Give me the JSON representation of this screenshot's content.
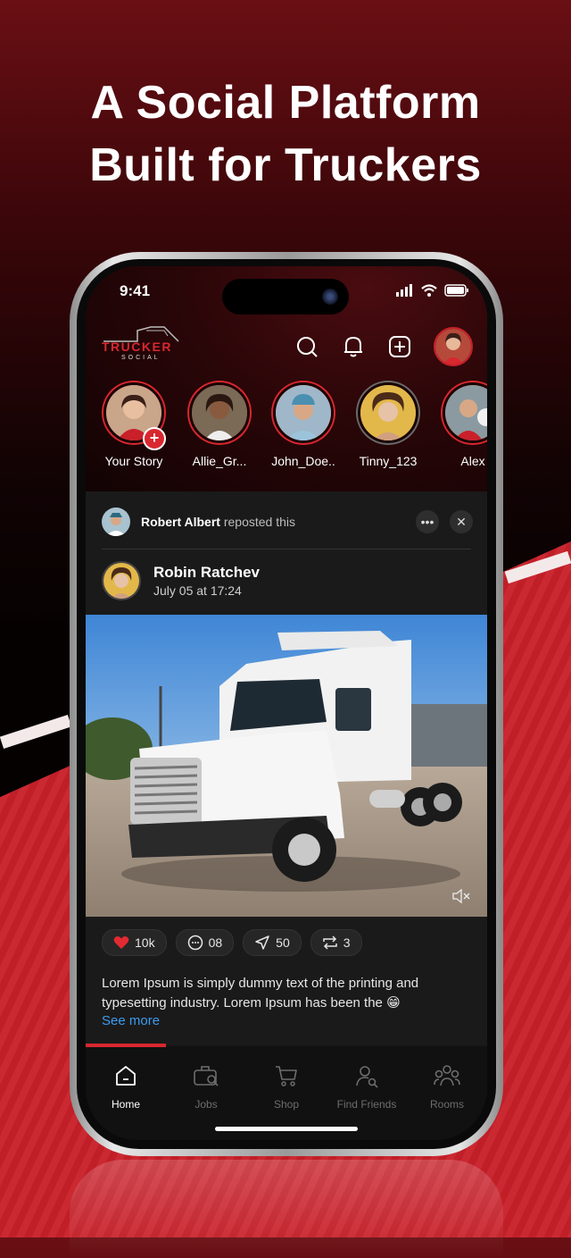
{
  "headline": {
    "line1": "A Social Platform",
    "line2": "Built for Truckers"
  },
  "status_bar": {
    "time": "9:41"
  },
  "app": {
    "logo_text": "TRUCKER",
    "logo_sub": "SOCIAL"
  },
  "header_icons": [
    "search-icon",
    "bell-icon",
    "add-post-icon",
    "profile-avatar"
  ],
  "stories": [
    {
      "label": "Your Story",
      "ring": "#d9272f"
    },
    {
      "label": "Allie_Gr...",
      "ring": "#d9272f"
    },
    {
      "label": "John_Doe..",
      "ring": "#d9272f"
    },
    {
      "label": "Tinny_123",
      "ring": "#6a6a6a"
    },
    {
      "label": "Alex",
      "ring": "#d9272f"
    }
  ],
  "repost": {
    "user": "Robert Albert",
    "action": "reposted this"
  },
  "post": {
    "author": "Robin Ratchev",
    "date": "July 05 at 17:24",
    "likes": "10k",
    "comments": "08",
    "shares": "50",
    "reposts": "3",
    "caption": "Lorem Ipsum is simply dummy text of the printing and typesetting industry. Lorem Ipsum has been the 😁",
    "see_more": "See more"
  },
  "tabs": [
    {
      "label": "Home",
      "active": true
    },
    {
      "label": "Jobs",
      "active": false
    },
    {
      "label": "Shop",
      "active": false
    },
    {
      "label": "Find Friends",
      "active": false
    },
    {
      "label": "Rooms",
      "active": false
    }
  ],
  "colors": {
    "accent": "#d9272f",
    "link": "#3b9cf0",
    "background": "#141414"
  }
}
